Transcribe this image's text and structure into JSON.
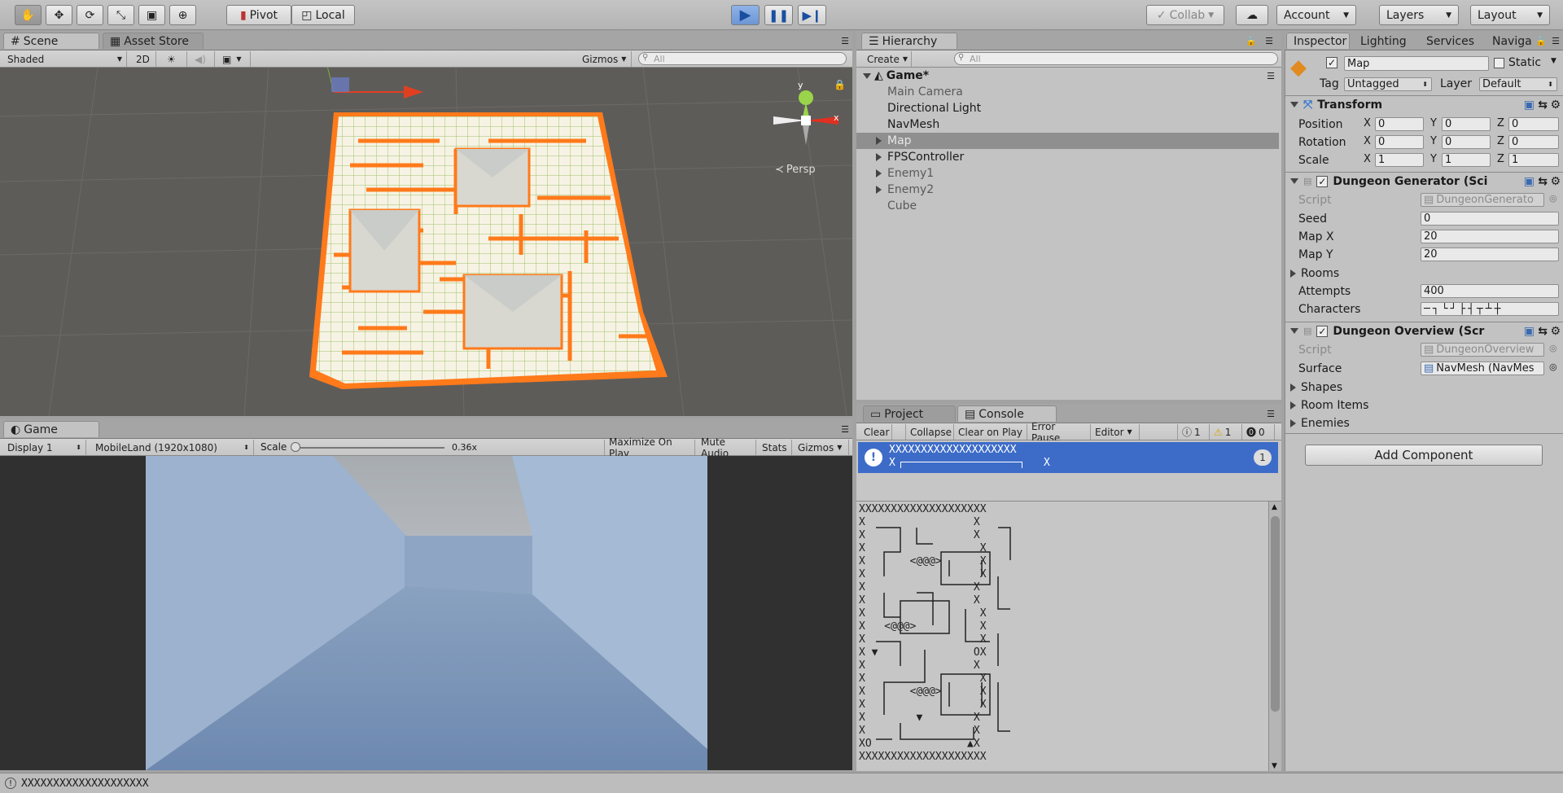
{
  "toolbar": {
    "pivot": "Pivot",
    "local": "Local",
    "collab": "Collab",
    "account": "Account",
    "layers": "Layers",
    "layout": "Layout"
  },
  "scene": {
    "tab": "Scene",
    "asset_tab": "Asset Store",
    "shading": "Shaded",
    "mode_2d": "2D",
    "gizmos": "Gizmos",
    "search_placeholder": "All",
    "persp": "Persp",
    "axis_y": "y",
    "axis_x": "x"
  },
  "game": {
    "tab": "Game",
    "display": "Display 1",
    "resolution": "MobileLand (1920x1080)",
    "scale_label": "Scale",
    "scale_value": "0.36x",
    "scale_level": 0.0,
    "maximize": "Maximize On Play",
    "mute": "Mute Audio",
    "stats": "Stats",
    "gizmos": "Gizmos"
  },
  "hierarchy": {
    "tab": "Hierarchy",
    "create": "Create",
    "search_placeholder": "All",
    "scene_name": "Game*",
    "items": [
      {
        "label": "Main Camera"
      },
      {
        "label": "Directional Light"
      },
      {
        "label": "NavMesh"
      },
      {
        "label": "Map"
      },
      {
        "label": "FPSController"
      },
      {
        "label": "Enemy1"
      },
      {
        "label": "Enemy2"
      },
      {
        "label": "Cube"
      }
    ]
  },
  "console": {
    "project_tab": "Project",
    "console_tab": "Console",
    "clear": "Clear",
    "collapse": "Collapse",
    "clear_on_play": "Clear on Play",
    "error_pause": "Error Pause",
    "editor": "Editor",
    "count_info": "1",
    "count_warn": "1",
    "count_error": "0",
    "entry_line1": "XXXXXXXXXXXXXXXXXXXX",
    "entry_line2": "X",
    "entry_line2_end": "X",
    "entry_count": "1",
    "detail_lines": [
      "XXXXXXXXXXXXXXXXXXXX",
      "X                 X",
      "X                 X",
      "X                  X",
      "X       <@@@>      X",
      "X                  X",
      "X                 X",
      "X                 X",
      "X                  X",
      "X   <@@@>          X",
      "X                  X",
      "X ▼               OX",
      "X                 X",
      "X                  X",
      "X       <@@@>      X",
      "X                  X",
      "X        ▼        X",
      "X                 X",
      "XO               ▲X",
      "XXXXXXXXXXXXXXXXXXXX"
    ]
  },
  "inspector": {
    "tabs": [
      "Inspector",
      "Lighting",
      "Services",
      "Navigation"
    ],
    "object_name": "Map",
    "static_label": "Static",
    "tag_label": "Tag",
    "tag_value": "Untagged",
    "layer_label": "Layer",
    "layer_value": "Default",
    "transform": {
      "title": "Transform",
      "position_label": "Position",
      "rotation_label": "Rotation",
      "scale_label": "Scale",
      "position": [
        "0",
        "0",
        "0"
      ],
      "rotation": [
        "0",
        "0",
        "0"
      ],
      "scale": [
        "1",
        "1",
        "1"
      ],
      "x": "X",
      "y": "Y",
      "z": "Z"
    },
    "dungeon_generator": {
      "title": "Dungeon Generator (Sci",
      "script_label": "Script",
      "script_value": "DungeonGenerato",
      "seed_label": "Seed",
      "seed_value": "0",
      "mapx_label": "Map X",
      "mapx_value": "20",
      "mapy_label": "Map Y",
      "mapy_value": "20",
      "rooms_label": "Rooms",
      "attempts_label": "Attempts",
      "attempts_value": "400",
      "characters_label": "Characters",
      "characters_value": "─┐└┘├┤┬┴┼"
    },
    "dungeon_overview": {
      "title": "Dungeon Overview (Scr",
      "script_label": "Script",
      "script_value": "DungeonOverview",
      "surface_label": "Surface",
      "surface_value": "NavMesh (NavMes",
      "shapes_label": "Shapes",
      "room_items_label": "Room Items",
      "enemies_label": "Enemies"
    },
    "add_component": "Add Component"
  },
  "status_bar": {
    "message": "XXXXXXXXXXXXXXXXXXXX"
  }
}
